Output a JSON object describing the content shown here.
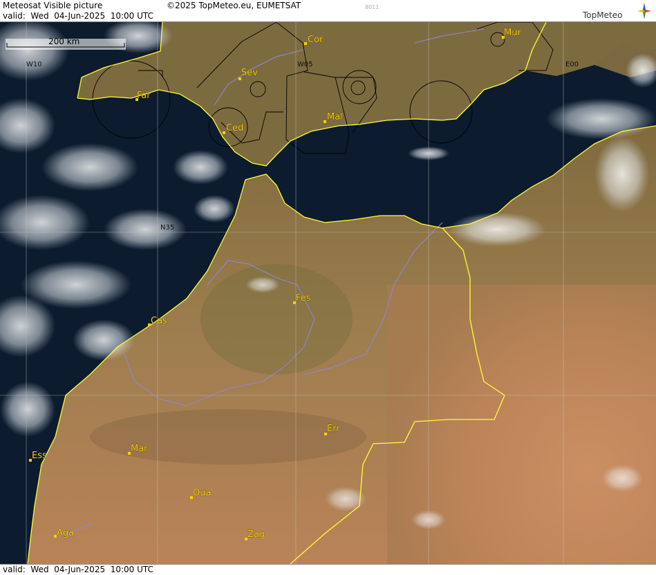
{
  "header": {
    "title": "Meteosat Visible picture",
    "copyright": "©2025 TopMeteo.eu, EUMETSAT",
    "code": "8011",
    "valid": "valid:  Wed  04-Jun-2025  10:00 UTC"
  },
  "logo": {
    "text": "TopMeteo",
    "icon": "compass-star-icon"
  },
  "footer": {
    "valid": "valid:  Wed  04-Jun-2025  10:00 UTC"
  },
  "scale": {
    "label": "200 km"
  },
  "grid": {
    "lon_labels": [
      "W10",
      "W05",
      "E00"
    ],
    "lat_labels": [
      "N35"
    ]
  },
  "cities": [
    "Cor",
    "Mur",
    "Sev",
    "Far",
    "Ced",
    "Mal",
    "Fes",
    "Cas",
    "Err",
    "Mar",
    "Ess",
    "Oua",
    "Aga",
    "Zag"
  ],
  "colors": {
    "sea": "#0c1b2e",
    "land_north": "#8a7444",
    "land_south": "#c88a5c",
    "border": "#ffff33",
    "city": "#ffd000",
    "river": "#8f86d6"
  }
}
